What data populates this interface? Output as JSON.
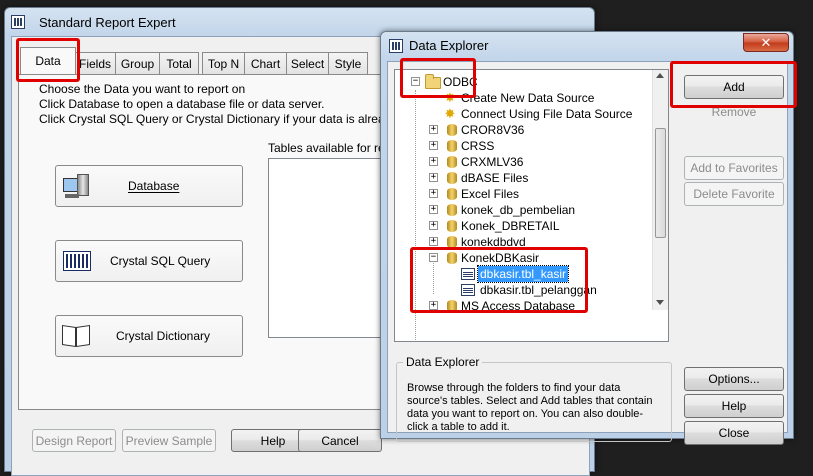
{
  "report_expert": {
    "title": "Standard Report Expert",
    "tabs": [
      "Data",
      "Fields",
      "Group",
      "Total",
      "Top N",
      "Chart",
      "Select",
      "Style"
    ],
    "instructions": [
      "Choose the Data you want to report on",
      "Click Database to open a database file or data server.",
      "Click Crystal SQL Query or Crystal Dictionary if your data is already saved"
    ],
    "tables_label": "Tables available for repo",
    "buttons": {
      "database": "Database",
      "sql_query": "Crystal SQL Query",
      "dictionary": "Crystal Dictionary"
    },
    "footer": {
      "design_report": "Design Report",
      "preview_sample": "Preview Sample",
      "help": "Help",
      "cancel": "Cancel"
    }
  },
  "data_explorer": {
    "title": "Data Explorer",
    "tree": {
      "root": "ODBC",
      "items": [
        "Create New Data Source",
        "Connect Using File Data Source",
        "CROR8V36",
        "CRSS",
        "CRXMLV36",
        "dBASE Files",
        "Excel Files",
        "konek_db_pembelian",
        "Konek_DBRETAIL",
        "konekdbdvd",
        "KonekDBKasir",
        "dbkasir.tbl_kasir",
        "dbkasir.tbl_pelanggan",
        "MS Access Database"
      ]
    },
    "buttons": {
      "add": "Add",
      "remove": "Remove",
      "add_to_favorites": "Add to Favorites",
      "delete_favorite": "Delete Favorite",
      "options": "Options...",
      "help": "Help",
      "close": "Close"
    },
    "info": {
      "heading": "Data Explorer",
      "text": "Browse through the folders to find your data source's tables.  Select and Add tables that contain data you want to report on.  You can also double-click a table to add it."
    },
    "close_glyph": "✕"
  },
  "colors": {
    "highlight_red": "#e00000",
    "selection_blue": "#3399ff"
  }
}
